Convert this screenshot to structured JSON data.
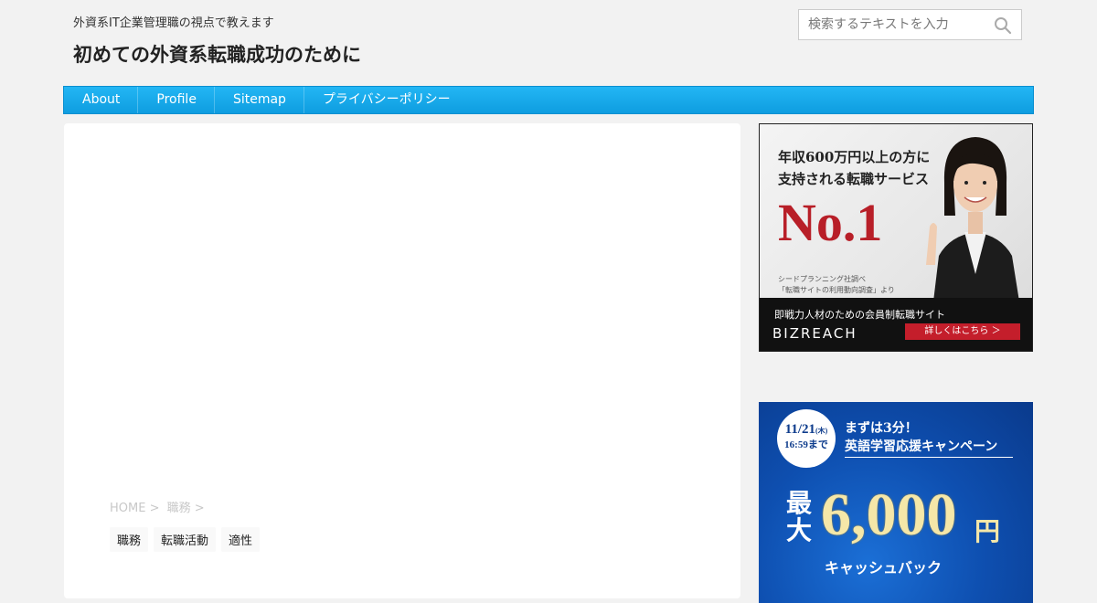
{
  "header": {
    "tagline": "外資系IT企業管理職の視点で教えます",
    "title": "初めての外資系転職成功のために"
  },
  "search": {
    "placeholder": "検索するテキストを入力",
    "icon": "search-icon"
  },
  "nav": {
    "items": [
      "About",
      "Profile",
      "Sitemap",
      "プライバシーポリシー"
    ]
  },
  "breadcrumb": {
    "items": [
      "HOME >",
      "職務 >"
    ]
  },
  "tags": [
    "職務",
    "転職活動",
    "適性"
  ],
  "ads": {
    "bizreach": {
      "headline_1": "年収600万円以上の方に",
      "headline_2": "支持される転職サービス",
      "rank": "No.1",
      "source_1": "シードプランニング社調べ",
      "source_2": "「転職サイトの利用動向調査」より",
      "sub": "即戦力人材のための会員制転職サイト",
      "logo": "BIZREACH",
      "cta": "詳しくはこちら ＞"
    },
    "english": {
      "date": "11/21",
      "weekday": "(木)",
      "time": "16:59まで",
      "line1": "まずは3分！",
      "line2": "英語学習応援キャンペーン",
      "max": "最大",
      "amount": "6,000",
      "yen": "円",
      "cashback": "キャッシュバック"
    }
  },
  "colors": {
    "nav_bg": "#1aa9ec",
    "page_bg": "#f2f2f2",
    "ad_red": "#b81f28",
    "ad_blue": "#0e4fb0"
  }
}
